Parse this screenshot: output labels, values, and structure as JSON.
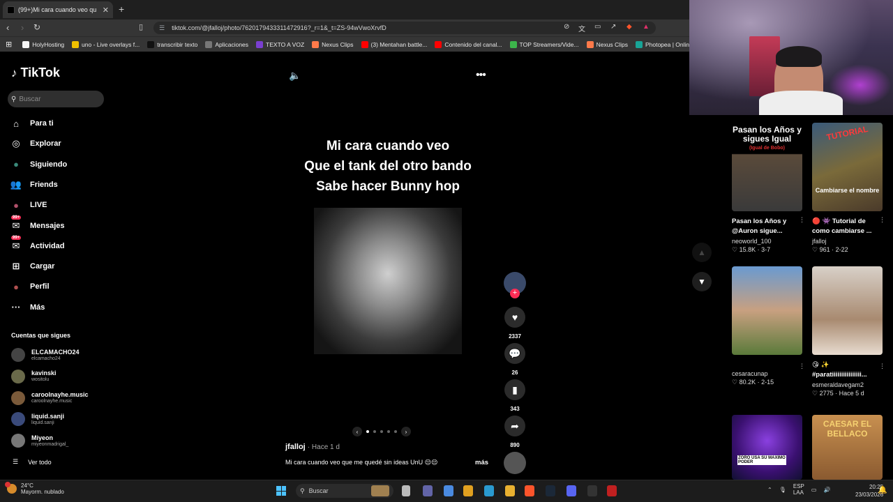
{
  "browser": {
    "tab_title": "(99+)Mi cara cuando veo qu",
    "url": "tiktok.com/@jfalloj/photo/7620179433311472916?_r=1&_t=ZS-94wVwoXrvfD",
    "bookmarks": [
      {
        "label": "HolyHosting",
        "color": "#f5f5f5"
      },
      {
        "label": "uno - Live overlays f...",
        "color": "#f0c000"
      },
      {
        "label": "transcribir texto",
        "color": "#111111"
      },
      {
        "label": "Aplicaciones",
        "color": "#777777"
      },
      {
        "label": "TEXTO A VOZ",
        "color": "#7a3fd0"
      },
      {
        "label": "Nexus Clips",
        "color": "#ff7a4a"
      },
      {
        "label": "(3) Mentahan battle...",
        "color": "#ff0000"
      },
      {
        "label": "Contenido del canal...",
        "color": "#ff0000"
      },
      {
        "label": "TOP Streamers/Vide...",
        "color": "#3cb44b"
      },
      {
        "label": "Nexus Clips",
        "color": "#ff7a4a"
      },
      {
        "label": "Photopea | Online P...",
        "color": "#18a497"
      }
    ]
  },
  "tiktok": {
    "logo": "TikTok",
    "search_placeholder": "Buscar",
    "menu": [
      {
        "label": "Para ti",
        "icon": "home-icon"
      },
      {
        "label": "Explorar",
        "icon": "compass-icon"
      },
      {
        "label": "Siguiendo",
        "icon": "following-avatar-icon"
      },
      {
        "label": "Friends",
        "icon": "friends-icon"
      },
      {
        "label": "LIVE",
        "icon": "live-icon"
      },
      {
        "label": "Mensajes",
        "icon": "messages-icon",
        "badge": "99+"
      },
      {
        "label": "Actividad",
        "icon": "activity-icon",
        "badge": "99+"
      },
      {
        "label": "Cargar",
        "icon": "upload-icon"
      },
      {
        "label": "Perfil",
        "icon": "profile-icon"
      },
      {
        "label": "Más",
        "icon": "more-icon"
      }
    ],
    "following_title": "Cuentas que sigues",
    "following": [
      {
        "name": "ELCAMACHO24",
        "handle": "elcamacho24"
      },
      {
        "name": "kavinski",
        "handle": "wositolu"
      },
      {
        "name": "caroolnayhe.music",
        "handle": "caroolnayhe.music"
      },
      {
        "name": "liquid.sanji",
        "handle": "liquid.sanji"
      },
      {
        "name": "Miyeon",
        "handle": "miyeonmadrigal_"
      }
    ],
    "see_all": "Ver todo"
  },
  "post": {
    "overlay_lines": [
      "Mi cara cuando veo",
      "Que el tank del otro bando",
      "Sabe hacer Bunny hop"
    ],
    "author": "jfalloj",
    "time": "· Hace 1 d",
    "description": "Mi cara cuando veo que me quedé sin ideas UnU 😔😔",
    "more": "más",
    "likes": "2337",
    "comments": "26",
    "saves": "343",
    "shares": "890",
    "slide_count": 5,
    "active_slide": 0
  },
  "recommended": [
    {
      "title": "Pasan los Años y @Auron sigue...",
      "user": "neoworld_100",
      "likes": "15.8K",
      "date": "3-7",
      "thumb_text": "Pasan los Años y sigues Igual",
      "thumb_sub": "(Igual de Bobo)"
    },
    {
      "title": "🔴 👾 Tutorial de como cambiarse ...",
      "user": "jfalloj",
      "likes": "961",
      "date": "2-22",
      "thumb_text": "TUTORIAL",
      "thumb_sub": "Cambiarse el nombre"
    },
    {
      "title": "",
      "user": "cesaracunap",
      "likes": "80.2K",
      "date": "2-15",
      "thumb_text": "",
      "thumb_sub": ""
    },
    {
      "title": "😘 ✨ #paratiiiiiiiiiiiiiiii...",
      "user": "esmeraldavegam2",
      "likes": "2775",
      "date": "Hace 5 d",
      "thumb_text": "",
      "thumb_sub": ""
    },
    {
      "title": "",
      "user": "",
      "likes": "",
      "date": "",
      "thumb_text": "ZORO USA SU MAXIMO PODER",
      "thumb_sub": ""
    },
    {
      "title": "",
      "user": "",
      "likes": "",
      "date": "",
      "thumb_text": "CAESAR EL BELLACO",
      "thumb_sub": ""
    }
  ],
  "taskbar": {
    "temp": "24°C",
    "weather": "Mayorm. nublado",
    "search": "Buscar",
    "lang": "ESP",
    "lang2": "LAA",
    "time": "20:25",
    "date": "23/03/2026"
  }
}
